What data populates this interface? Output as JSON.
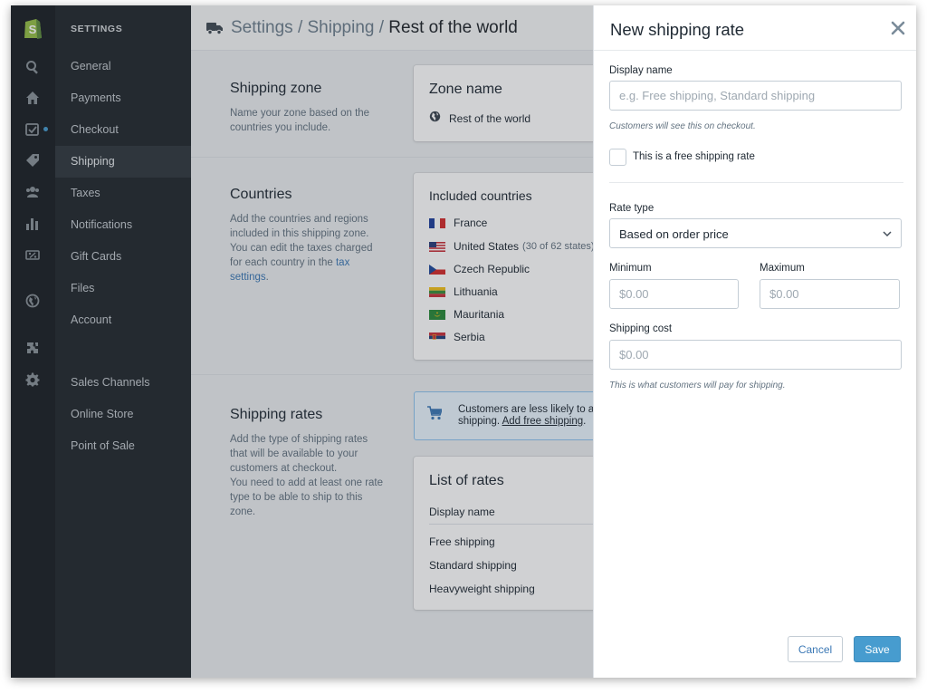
{
  "sidebar": {
    "title": "SETTINGS",
    "items": [
      {
        "label": "General"
      },
      {
        "label": "Payments"
      },
      {
        "label": "Checkout"
      },
      {
        "label": "Shipping",
        "active": true
      },
      {
        "label": "Taxes"
      },
      {
        "label": "Notifications"
      },
      {
        "label": "Gift Cards"
      },
      {
        "label": "Files"
      },
      {
        "label": "Account"
      },
      {
        "label": "Sales Channels"
      },
      {
        "label": "Online Store"
      },
      {
        "label": "Point of Sale"
      }
    ]
  },
  "rail_icons": [
    "search-icon",
    "home-icon",
    "orders-icon",
    "tag-icon",
    "customers-icon",
    "reports-icon",
    "discounts-icon",
    "globe-icon",
    "apps-icon",
    "gear-icon"
  ],
  "breadcrumb": {
    "settings": "Settings",
    "sep": "/",
    "shipping": "Shipping",
    "current": "Rest of the world"
  },
  "zone": {
    "heading": "Shipping zone",
    "description": "Name your zone based on the countries you include.",
    "card_title": "Zone name",
    "zone_value": "Rest of the world"
  },
  "countries": {
    "heading": "Countries",
    "description": "Add the countries and regions included in this shipping zone. You can edit the taxes charged for each country in the ",
    "link_text": "tax settings",
    "desc_end": ".",
    "card_title": "Included countries",
    "list": [
      {
        "name": "France",
        "note": ""
      },
      {
        "name": "United States",
        "note": "(30 of 62 states)"
      },
      {
        "name": "Czech Republic",
        "note": ""
      },
      {
        "name": "Lithuania",
        "note": ""
      },
      {
        "name": "Mauritania",
        "note": ""
      },
      {
        "name": "Serbia",
        "note": ""
      }
    ]
  },
  "rates": {
    "heading": "Shipping rates",
    "description": "Add the type of shipping rates that will be available to your customers at checkout.",
    "description2": "You need to add at least one rate type to be able to ship to this zone.",
    "banner_line1": "Customers are less likely to a",
    "banner_line2": "shipping.",
    "banner_link": "Add free shipping",
    "banner_end": ".",
    "list_title": "List of rates",
    "column": "Display name",
    "items": [
      "Free shipping",
      "Standard shipping",
      "Heavyweight shipping"
    ]
  },
  "panel": {
    "title": "New shipping rate",
    "display_name_label": "Display name",
    "display_name_placeholder": "e.g. Free shipping, Standard shipping",
    "display_name_value": "",
    "display_help": "Customers will see this on checkout.",
    "free_label": "This is a free shipping rate",
    "free_checked": false,
    "rate_type_label": "Rate type",
    "rate_type_value": "Based on order price",
    "min_label": "Minimum",
    "min_placeholder": "$0.00",
    "max_label": "Maximum",
    "max_placeholder": "$0.00",
    "cost_label": "Shipping cost",
    "cost_placeholder": "$0.00",
    "cost_help": "This is what customers will pay for shipping.",
    "cancel_label": "Cancel",
    "save_label": "Save"
  },
  "colors": {
    "accent": "#479ccf",
    "link": "#3b78b5",
    "sidebar": "#23292f",
    "rail": "#1c2126",
    "logo": "#95bf47"
  }
}
